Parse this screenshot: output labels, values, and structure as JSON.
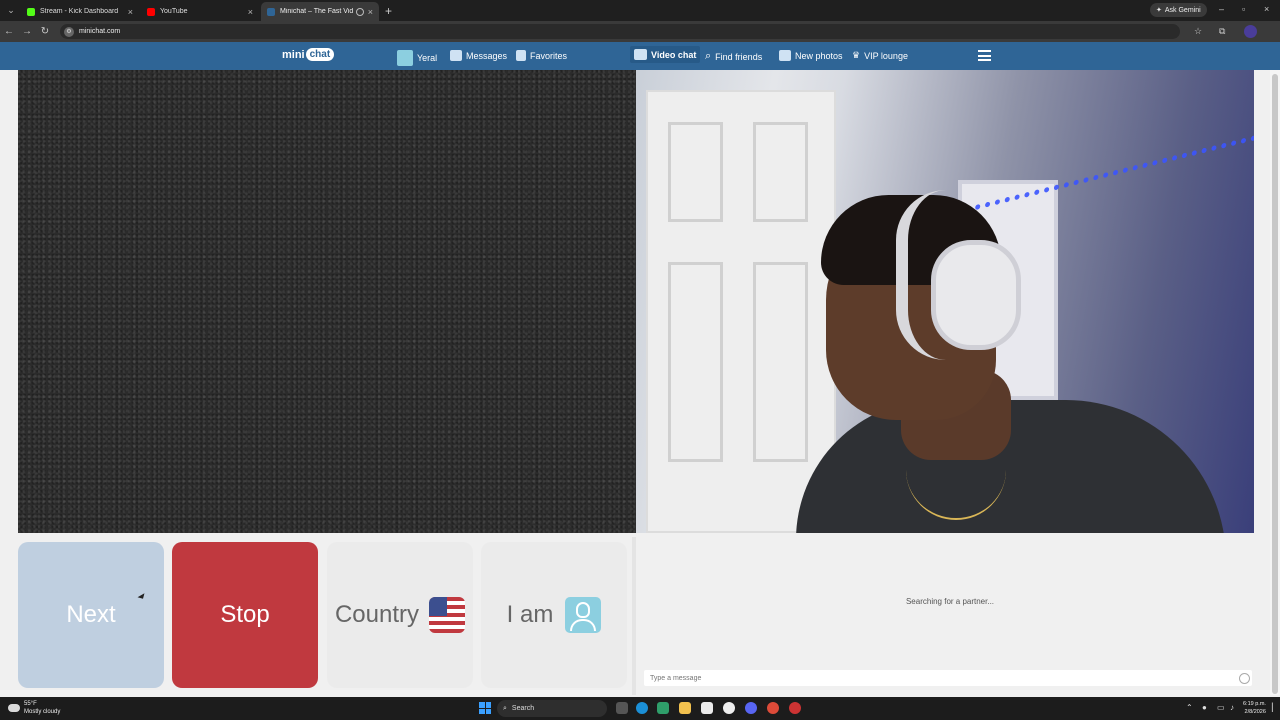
{
  "browser": {
    "tabs": [
      {
        "title": "Stream - Kick Dashboard",
        "favicon_color": "#53fc18"
      },
      {
        "title": "YouTube",
        "favicon_color": "#ff0000"
      },
      {
        "title": "Minichat – The Fast Video C",
        "favicon_color": "#2f6596"
      }
    ],
    "ask_gemini": "Ask Gemini",
    "url": "minichat.com"
  },
  "site": {
    "logo_left": "mini",
    "logo_right": "chat",
    "nav": {
      "profile": "Yeral",
      "messages": "Messages",
      "favorites": "Favorites",
      "video_chat": "Video chat",
      "find_friends": "Find friends",
      "new_photos": "New photos",
      "vip_lounge": "VIP lounge"
    },
    "controls": {
      "next": "Next",
      "stop": "Stop",
      "country": "Country",
      "i_am": "I am"
    },
    "chat": {
      "status": "Searching for a partner...",
      "placeholder": "Type a message"
    },
    "colors": {
      "header": "#2f6596",
      "next": "#bfcfe0",
      "stop": "#c0393f"
    }
  },
  "taskbar": {
    "weather_temp": "55°F",
    "weather_desc": "Mostly cloudy",
    "search": "Search",
    "time": "6:19 p.m.",
    "date": "2/8/2026"
  }
}
